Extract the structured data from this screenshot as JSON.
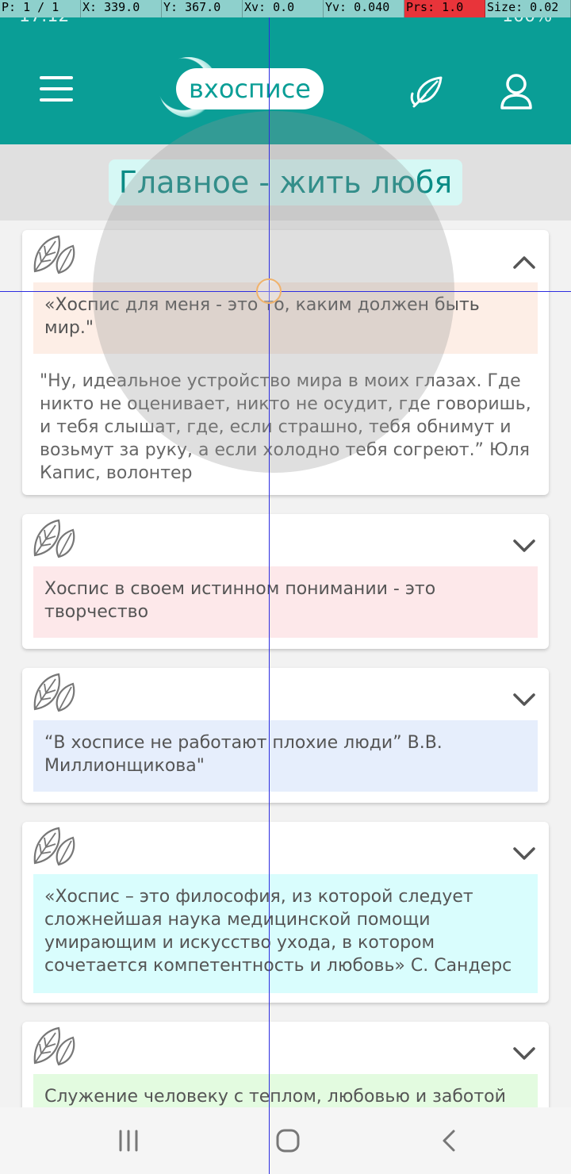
{
  "debug": {
    "pointer": "P: 1 / 1",
    "x": "X: 339.0",
    "y": "Y: 367.0",
    "xv": "Xv: 0.0",
    "yv": "Yv: 0.040",
    "prs": "Prs: 1.0",
    "size": "Size: 0.02"
  },
  "status_bar": {
    "time": "17:12",
    "battery": "100%"
  },
  "app": {
    "logo_text": "вхосписе"
  },
  "section_title": "Главное - жить любя",
  "cards": [
    {
      "quote": "«Хоспис для меня - это то, каким должен быть мир.\"",
      "quote_bg": "#fdeee6",
      "expanded": true,
      "body": "\"Ну, идеальное устройство мира в моих глазах. Где никто не оценивает, никто не осудит, где говоришь, и тебя слышат, где, если страшно, тебя обнимут и возьмут за руку, а если холодно тебя согреют.” Юля Капис, волонтер"
    },
    {
      "quote": "Хоспис в своем истинном понимании - это творчество",
      "quote_bg": "#fde8ea",
      "expanded": false
    },
    {
      "quote": "“В хосписе не работают плохие люди” В.В. Миллионщикова\"",
      "quote_bg": "#e6eefc",
      "expanded": false
    },
    {
      "quote": "«Хоспис – это философия, из которой следует сложнейшая наука медицинской помощи умирающим и искусство ухода, в котором сочетается компетентность и любовь» С. Сандерс",
      "quote_bg": "#d9fdfd",
      "expanded": false
    },
    {
      "quote": "Служение человеку с теплом, любовью и заботой",
      "quote_bg": "#e3fbe0",
      "expanded": false
    }
  ],
  "colors": {
    "primary": "#0a9e96",
    "title_pill": "#d6f8f5"
  }
}
